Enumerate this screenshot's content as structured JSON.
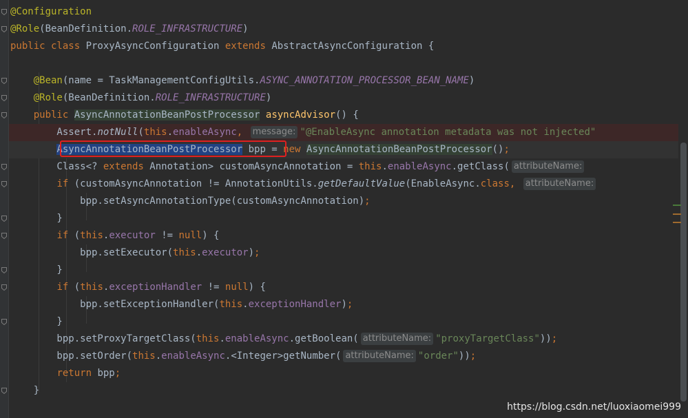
{
  "editor": {
    "lines": [
      [
        {
          "t": "@Configuration",
          "c": "ann"
        }
      ],
      [
        {
          "t": "@Role",
          "c": "ann"
        },
        {
          "t": "(BeanDefinition.",
          "c": "default"
        },
        {
          "t": "ROLE_INFRASTRUCTURE",
          "c": "const"
        },
        {
          "t": ")",
          "c": "default"
        }
      ],
      [
        {
          "t": "public class ",
          "c": "kw"
        },
        {
          "t": "ProxyAsyncConfiguration ",
          "c": "default"
        },
        {
          "t": "extends ",
          "c": "kw"
        },
        {
          "t": "AbstractAsyncConfiguration {",
          "c": "default"
        }
      ],
      [],
      [
        {
          "t": "    "
        },
        {
          "t": "@Bean",
          "c": "ann"
        },
        {
          "t": "(name = TaskManagementConfigUtils.",
          "c": "default"
        },
        {
          "t": "ASYNC_ANNOTATION_PROCESSOR_BEAN_NAME",
          "c": "const"
        },
        {
          "t": ")",
          "c": "default"
        }
      ],
      [
        {
          "t": "    "
        },
        {
          "t": "@Role",
          "c": "ann"
        },
        {
          "t": "(BeanDefinition.",
          "c": "default"
        },
        {
          "t": "ROLE_INFRASTRUCTURE",
          "c": "const"
        },
        {
          "t": ")",
          "c": "default"
        }
      ],
      [
        {
          "t": "    "
        },
        {
          "t": "public ",
          "c": "kw"
        },
        {
          "t": "AsyncAnnotationBeanPostProcessor",
          "c": "typehl"
        },
        {
          "t": " ",
          "c": "default"
        },
        {
          "t": "asyncAdvisor",
          "c": "method"
        },
        {
          "t": "() {",
          "c": "default"
        }
      ],
      [
        {
          "t": "        Assert.",
          "c": "default"
        },
        {
          "t": "notNull",
          "c": "static"
        },
        {
          "t": "(",
          "c": "default"
        },
        {
          "t": "this",
          "c": "kw"
        },
        {
          "t": ".",
          "c": "default"
        },
        {
          "t": "enableAsync",
          "c": "field"
        },
        {
          "t": ", ",
          "c": "kw"
        },
        {
          "t": "message:",
          "c": "hint"
        },
        {
          "t": "\"@EnableAsync annotation metadata was not injected\"",
          "c": "str"
        }
      ],
      [
        {
          "t": "        "
        },
        {
          "t": "AsyncAnnotationBeanPostProcessor",
          "c": "sel"
        },
        {
          "t": " bpp = ",
          "c": "default"
        },
        {
          "t": "new ",
          "c": "kw"
        },
        {
          "t": "AsyncAnnotationBeanPostProcessor",
          "c": "typehl"
        },
        {
          "t": "()",
          "c": "default"
        },
        {
          "t": ";",
          "c": "kw"
        }
      ],
      [
        {
          "t": "        Class<? ",
          "c": "default"
        },
        {
          "t": "extends ",
          "c": "kw"
        },
        {
          "t": "Annotation> customAsyncAnnotation = ",
          "c": "default"
        },
        {
          "t": "this",
          "c": "kw"
        },
        {
          "t": ".",
          "c": "default"
        },
        {
          "t": "enableAsync",
          "c": "field"
        },
        {
          "t": ".getClass(",
          "c": "default"
        },
        {
          "t": "attributeName:",
          "c": "hint"
        }
      ],
      [
        {
          "t": "        "
        },
        {
          "t": "if ",
          "c": "kw"
        },
        {
          "t": "(customAsyncAnnotation != AnnotationUtils.",
          "c": "default"
        },
        {
          "t": "getDefaultValue",
          "c": "static"
        },
        {
          "t": "(EnableAsync.",
          "c": "default"
        },
        {
          "t": "class, ",
          "c": "kw"
        },
        {
          "t": "attributeName:",
          "c": "hint"
        }
      ],
      [
        {
          "t": "            bpp.setAsyncAnnotationType(customAsyncAnnotation)",
          "c": "default"
        },
        {
          "t": ";",
          "c": "kw"
        }
      ],
      [
        {
          "t": "        }",
          "c": "default"
        }
      ],
      [
        {
          "t": "        "
        },
        {
          "t": "if ",
          "c": "kw"
        },
        {
          "t": "(",
          "c": "default"
        },
        {
          "t": "this",
          "c": "kw"
        },
        {
          "t": ".",
          "c": "default"
        },
        {
          "t": "executor",
          "c": "field"
        },
        {
          "t": " != ",
          "c": "default"
        },
        {
          "t": "null",
          "c": "kw"
        },
        {
          "t": ") {",
          "c": "default"
        }
      ],
      [
        {
          "t": "            bpp.setExecutor(",
          "c": "default"
        },
        {
          "t": "this",
          "c": "kw"
        },
        {
          "t": ".",
          "c": "default"
        },
        {
          "t": "executor",
          "c": "field"
        },
        {
          "t": ")",
          "c": "default"
        },
        {
          "t": ";",
          "c": "kw"
        }
      ],
      [
        {
          "t": "        }",
          "c": "default"
        }
      ],
      [
        {
          "t": "        "
        },
        {
          "t": "if ",
          "c": "kw"
        },
        {
          "t": "(",
          "c": "default"
        },
        {
          "t": "this",
          "c": "kw"
        },
        {
          "t": ".",
          "c": "default"
        },
        {
          "t": "exceptionHandler",
          "c": "field"
        },
        {
          "t": " != ",
          "c": "default"
        },
        {
          "t": "null",
          "c": "kw"
        },
        {
          "t": ") {",
          "c": "default"
        }
      ],
      [
        {
          "t": "            bpp.setExceptionHandler(",
          "c": "default"
        },
        {
          "t": "this",
          "c": "kw"
        },
        {
          "t": ".",
          "c": "default"
        },
        {
          "t": "exceptionHandler",
          "c": "field"
        },
        {
          "t": ")",
          "c": "default"
        },
        {
          "t": ";",
          "c": "kw"
        }
      ],
      [
        {
          "t": "        }",
          "c": "default"
        }
      ],
      [
        {
          "t": "        bpp.setProxyTargetClass(",
          "c": "default"
        },
        {
          "t": "this",
          "c": "kw"
        },
        {
          "t": ".",
          "c": "default"
        },
        {
          "t": "enableAsync",
          "c": "field"
        },
        {
          "t": ".getBoolean(",
          "c": "default"
        },
        {
          "t": "attributeName:",
          "c": "hint"
        },
        {
          "t": "\"proxyTargetClass\"",
          "c": "str"
        },
        {
          "t": "))",
          "c": "default"
        },
        {
          "t": ";",
          "c": "kw"
        }
      ],
      [
        {
          "t": "        bpp.setOrder(",
          "c": "default"
        },
        {
          "t": "this",
          "c": "kw"
        },
        {
          "t": ".",
          "c": "default"
        },
        {
          "t": "enableAsync",
          "c": "field"
        },
        {
          "t": ".<Integer>getNumber(",
          "c": "default"
        },
        {
          "t": "attributeName:",
          "c": "hint"
        },
        {
          "t": "\"order\"",
          "c": "str"
        },
        {
          "t": "))",
          "c": "default"
        },
        {
          "t": ";",
          "c": "kw"
        }
      ],
      [
        {
          "t": "        "
        },
        {
          "t": "return ",
          "c": "kw"
        },
        {
          "t": "bpp",
          "c": "default"
        },
        {
          "t": ";",
          "c": "kw"
        }
      ],
      [
        {
          "t": "    }",
          "c": "default"
        }
      ]
    ]
  },
  "colors": {
    "background": "#2b2b2b",
    "error_row": "#3d2727",
    "caret_row": "#323232",
    "selection_box": "#e02020"
  },
  "watermark": "https://blog.csdn.net/luoxiaomei999"
}
